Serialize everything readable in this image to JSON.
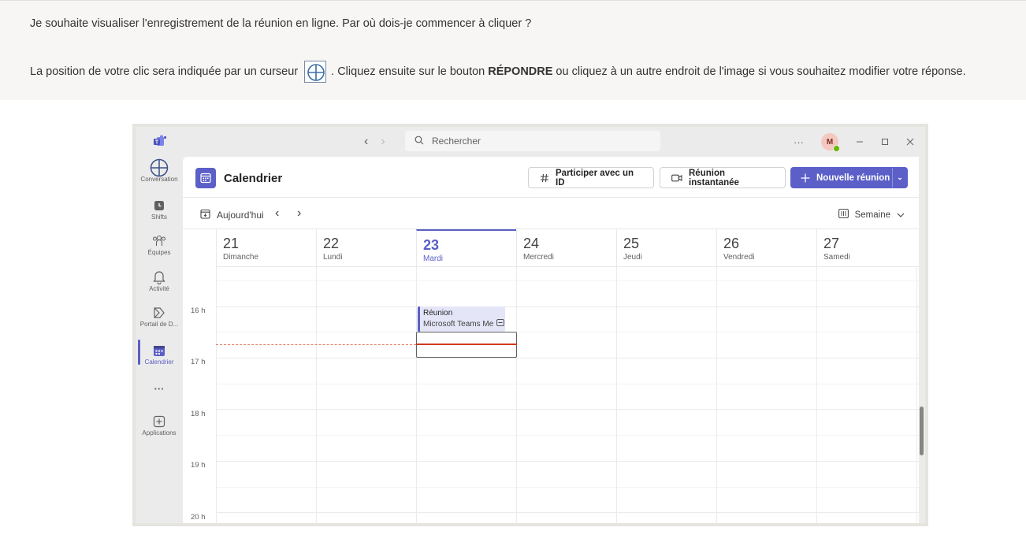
{
  "question": {
    "line1": "Je souhaite visualiser l'enregistrement de la réunion en ligne. Par où dois-je commencer à cliquer ?",
    "line2_before": "La position de votre clic sera indiquée par un curseur",
    "line2_mid": ". Cliquez ensuite sur le bouton",
    "line2_bold": "RÉPONDRE",
    "line2_after": "ou cliquez à un autre endroit de l'image si vous souhaitez modifier votre réponse."
  },
  "titlebar": {
    "search_placeholder": "Rechercher",
    "more": "···",
    "avatar_initial": "M"
  },
  "rail": {
    "items": [
      {
        "label": "Conversation",
        "icon": "chat-icon"
      },
      {
        "label": "Shifts",
        "icon": "shifts-icon"
      },
      {
        "label": "Équipes",
        "icon": "teams-icon"
      },
      {
        "label": "Activité",
        "icon": "bell-icon"
      },
      {
        "label": "Portail de D...",
        "icon": "portal-icon"
      },
      {
        "label": "Calendrier",
        "icon": "calendar-icon"
      },
      {
        "label": "···",
        "icon": "more-icon"
      },
      {
        "label": "Applications",
        "icon": "apps-icon"
      }
    ]
  },
  "header": {
    "title": "Calendrier",
    "join_label": "Participer avec un ID",
    "instant_label": "Réunion instantanée",
    "new_label": "Nouvelle réunion"
  },
  "toolbar": {
    "today_label": "Aujourd'hui",
    "view_label": "Semaine"
  },
  "days": [
    {
      "num": "21",
      "name": "Dimanche"
    },
    {
      "num": "22",
      "name": "Lundi"
    },
    {
      "num": "23",
      "name": "Mardi"
    },
    {
      "num": "24",
      "name": "Mercredi"
    },
    {
      "num": "25",
      "name": "Jeudi"
    },
    {
      "num": "26",
      "name": "Vendredi"
    },
    {
      "num": "27",
      "name": "Samedi"
    }
  ],
  "hours": [
    "16 h",
    "17 h",
    "18 h",
    "19 h",
    "20 h"
  ],
  "event": {
    "title": "Réunion",
    "subtitle": "Microsoft Teams Me"
  },
  "colors": {
    "accent": "#5b5fc7",
    "now_line": "#d13a1a"
  }
}
